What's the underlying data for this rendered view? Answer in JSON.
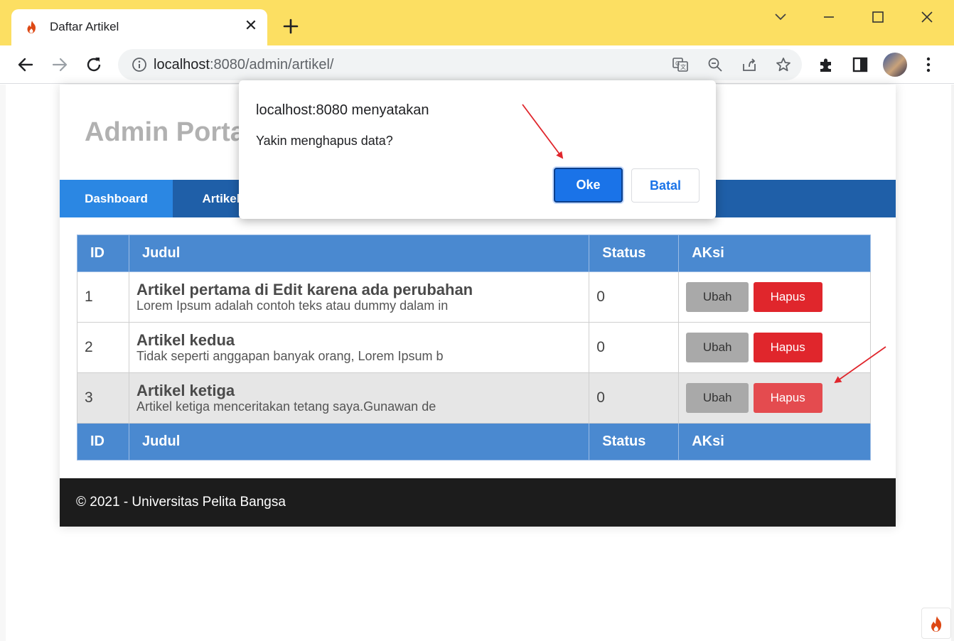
{
  "browser": {
    "tab_title": "Daftar Artikel",
    "url_host": "localhost",
    "url_path": ":8080/admin/artikel/",
    "accent_color": "#fcdf62"
  },
  "site": {
    "title": "Admin Portal",
    "nav": [
      {
        "label": "Dashboard",
        "active": true
      },
      {
        "label": "Artikel",
        "active": false
      }
    ]
  },
  "table": {
    "headers": [
      "ID",
      "Judul",
      "Status",
      "AKsi"
    ],
    "rows": [
      {
        "id": "1",
        "title": "Artikel pertama di Edit karena ada perubahan",
        "snippet": "Lorem Ipsum adalah contoh teks atau dummy dalam in",
        "status": "0",
        "edit_label": "Ubah",
        "delete_label": "Hapus"
      },
      {
        "id": "2",
        "title": "Artikel kedua",
        "snippet": "Tidak seperti anggapan banyak orang, Lorem Ipsum b",
        "status": "0",
        "edit_label": "Ubah",
        "delete_label": "Hapus"
      },
      {
        "id": "3",
        "title": "Artikel ketiga",
        "snippet": "Artikel ketiga menceritakan tetang saya.Gunawan de",
        "status": "0",
        "edit_label": "Ubah",
        "delete_label": "Hapus"
      }
    ]
  },
  "footer": {
    "text": "© 2021 - Universitas Pelita Bangsa"
  },
  "dialog": {
    "title": "localhost:8080 menyatakan",
    "message": "Yakin menghapus data?",
    "ok_label": "Oke",
    "cancel_label": "Batal"
  }
}
